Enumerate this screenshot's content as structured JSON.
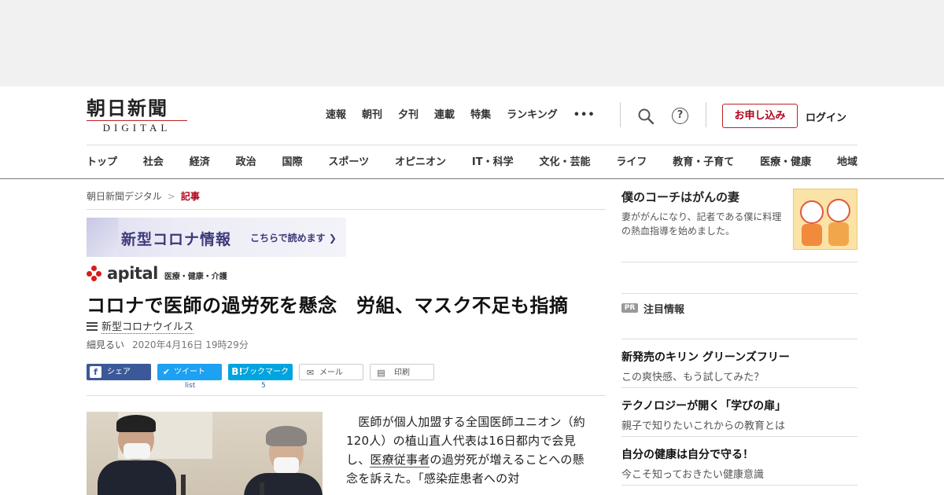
{
  "logo": {
    "main": "朝日新聞",
    "sub": "DIGITAL"
  },
  "topnav": [
    "速報",
    "朝刊",
    "夕刊",
    "連載",
    "特集",
    "ランキング"
  ],
  "more_glyph": "•••",
  "help_glyph": "?",
  "signup_label": "お申し込み",
  "login_label": "ログイン",
  "catnav": [
    "トップ",
    "社会",
    "経済",
    "政治",
    "国際",
    "スポーツ",
    "オピニオン",
    "IT・科学",
    "文化・芸能",
    "ライフ",
    "教育・子育て",
    "医療・健康",
    "地域"
  ],
  "breadcrumb": {
    "home": "朝日新聞デジタル",
    "sep": ">",
    "current": "記事"
  },
  "corona_banner": {
    "title": "新型コロナ情報",
    "link": "こちらで読めます ❯"
  },
  "apital": {
    "logo": "apital",
    "category": "医療・健康・介護"
  },
  "article": {
    "headline": "コロナで医師の過労死を懸念　労組、マスク不足も指摘",
    "tag": "新型コロナウイルス",
    "author": "細見るい",
    "date": "2020年4月16日 19時29分",
    "body_1": "　医師が個人加盟する全国医師ユニオン（約120人）の植山直人代表は16日都内で会見し、",
    "body_link": "医療従事者",
    "body_2": "の過労死が増えることへの懸念を訴えた。「感染症患者への対"
  },
  "share": {
    "facebook": {
      "icon": "f",
      "label": "シェア"
    },
    "twitter": {
      "icon": "✔",
      "label": "ツイート",
      "count": "list"
    },
    "hatena": {
      "icon": "B!",
      "label": "ブックマーク",
      "count": "5"
    },
    "mail": {
      "icon": "✉",
      "label": "メール"
    },
    "print": {
      "icon": "▤",
      "label": "印刷"
    }
  },
  "side_promo": {
    "title": "僕のコーチはがんの妻",
    "desc": "妻ががんになり、記者である僕に料理の熱血指導を始めました。"
  },
  "pr": {
    "badge": "PR",
    "label": "注目情報",
    "items": [
      {
        "title": "新発売のキリン グリーンズフリー",
        "desc": "この爽快感、もう試してみた？"
      },
      {
        "title": "テクノロジーが開く「学びの扉」",
        "desc": "親子で知りたいこれからの教育とは"
      },
      {
        "title": "自分の健康は自分で守る！",
        "desc": "今こそ知っておきたい健康意識"
      }
    ]
  },
  "colors": {
    "brand_red": "#b2001a",
    "facebook": "#3b5998",
    "twitter": "#1da1f2",
    "hatena": "#00a4de"
  }
}
